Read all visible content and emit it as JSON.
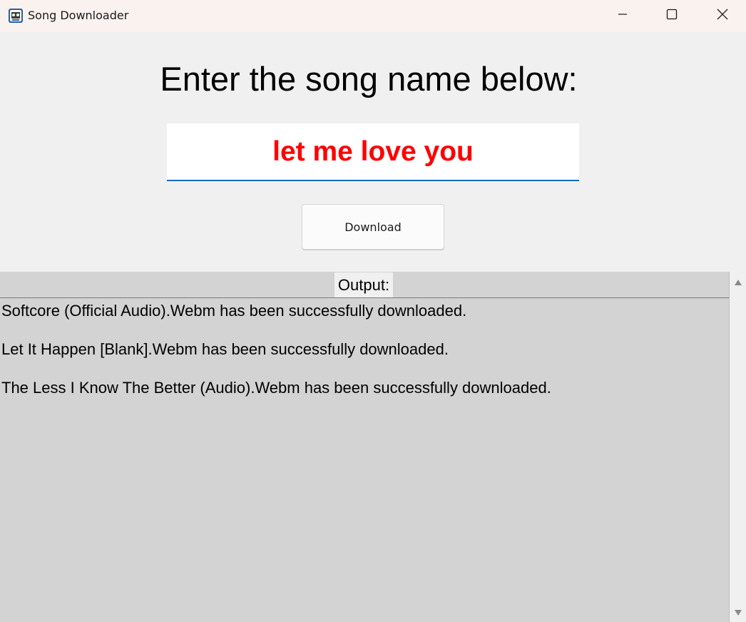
{
  "window": {
    "title": "Song Downloader",
    "icons": {
      "app": "app-icon",
      "minimize": "minimize-icon",
      "maximize": "maximize-icon",
      "close": "close-icon"
    }
  },
  "main": {
    "heading": "Enter the song name below:",
    "song_input": {
      "value": "let me love you",
      "text_color": "#ff0000"
    },
    "download_button_label": "Download"
  },
  "output": {
    "label": "Output:",
    "lines": [
      "Softcore (Official Audio).Webm has been successfully downloaded.",
      "Let It Happen [Blank].Webm has been successfully downloaded.",
      "The Less I Know The Better (Audio).Webm has been successfully downloaded."
    ]
  },
  "scrollbar": {
    "up_icon": "scroll-up-arrow-icon",
    "down_icon": "scroll-down-arrow-icon"
  },
  "colors": {
    "input_underline": "#1a68b5",
    "output_background": "#d3d3d3",
    "window_background": "#f0f0f0"
  }
}
